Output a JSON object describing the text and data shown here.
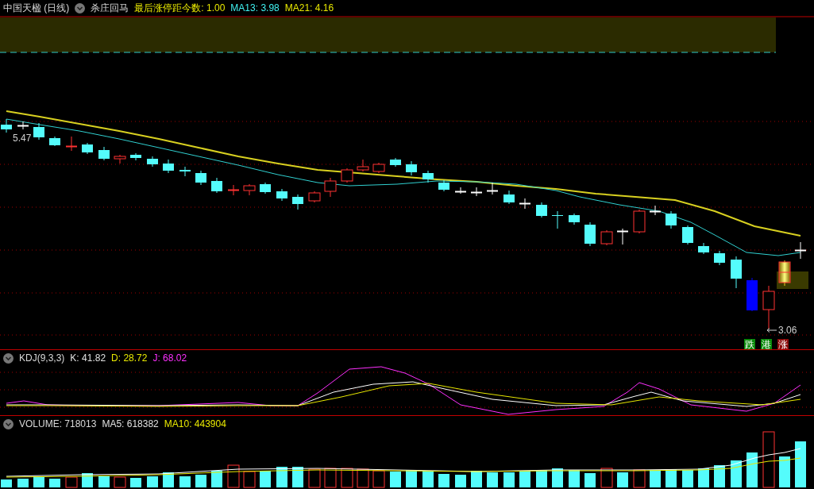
{
  "price_pane": {
    "title": "中国天楹 (日线)",
    "indicator": "杀庄回马",
    "readings": [
      {
        "text": "最后涨停距今数: 1.00",
        "color": "#e8e800"
      },
      {
        "text": "MA13: 3.98",
        "color": "#40f0f0"
      },
      {
        "text": "MA21: 4.16",
        "color": "#e8e800"
      }
    ],
    "high_label": "5.47",
    "low_label": "3.06",
    "signal_tags": [
      {
        "text": "跌",
        "color": "#0a8a0a"
      },
      {
        "text": "港",
        "color": "#0a8a0a"
      },
      {
        "text": "涨",
        "color": "#8a0a0a"
      }
    ]
  },
  "kdj_pane": {
    "title": "KDJ(9,3,3)",
    "readings": [
      {
        "text": "K: 41.82",
        "color": "#e0e0e0"
      },
      {
        "text": "D: 28.72",
        "color": "#e8e800"
      },
      {
        "text": "J: 68.02",
        "color": "#ff30ff"
      }
    ]
  },
  "volume_pane": {
    "title": "VOLUME: 718013",
    "readings": [
      {
        "text": "MA5: 618382",
        "color": "#e0e0e0"
      },
      {
        "text": "MA10: 443904",
        "color": "#e8e800"
      }
    ]
  }
}
